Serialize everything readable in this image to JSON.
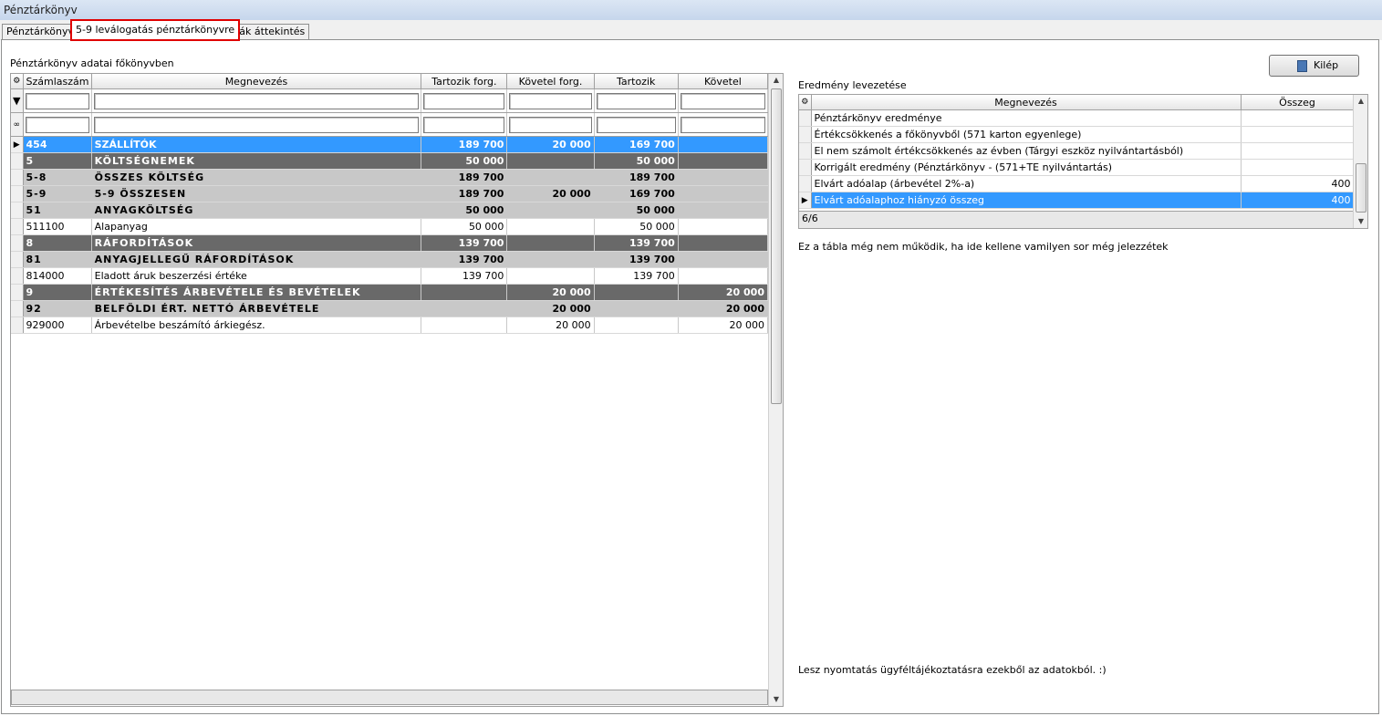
{
  "window": {
    "title": "Pénztárkönyv"
  },
  "tabs": [
    {
      "label": "Pénztárkönyv"
    },
    {
      "label": "5-9 leválogatás pénztárkönyvre"
    },
    {
      "label": "Hibák áttekintés"
    }
  ],
  "left": {
    "section_label": "Pénztárkönyv adatai főkönyvben",
    "columns": [
      "Számlaszám",
      "Megnevezés",
      "Tartozik forg.",
      "Követel forg.",
      "Tartozik",
      "Követel"
    ],
    "rows": [
      {
        "style": "sel",
        "cells": [
          "454",
          "SZÁLLÍTÓK",
          "189 700",
          "20 000",
          "169 700",
          ""
        ]
      },
      {
        "style": "dark",
        "cells": [
          "5",
          "KÖLTSÉGNEMEK",
          "50 000",
          "",
          "50 000",
          ""
        ]
      },
      {
        "style": "light",
        "cells": [
          "5-8",
          "ÖSSZES KÖLTSÉG",
          "189 700",
          "",
          "189 700",
          ""
        ]
      },
      {
        "style": "light",
        "cells": [
          "5-9",
          "5-9 ÖSSZESEN",
          "189 700",
          "20 000",
          "169 700",
          ""
        ]
      },
      {
        "style": "light",
        "cells": [
          "51",
          "ANYAGKÖLTSÉG",
          "50 000",
          "",
          "50 000",
          ""
        ]
      },
      {
        "style": "plain",
        "cells": [
          "511100",
          "Alapanyag",
          "50 000",
          "",
          "50 000",
          ""
        ]
      },
      {
        "style": "dark",
        "cells": [
          "8",
          "RÁFORDÍTÁSOK",
          "139 700",
          "",
          "139 700",
          ""
        ]
      },
      {
        "style": "light",
        "cells": [
          "81",
          "ANYAGJELLEGŰ RÁFORDÍTÁSOK",
          "139 700",
          "",
          "139 700",
          ""
        ]
      },
      {
        "style": "plain",
        "cells": [
          "814000",
          "Eladott áruk beszerzési értéke",
          "139 700",
          "",
          "139 700",
          ""
        ]
      },
      {
        "style": "dark",
        "cells": [
          "9",
          "ÉRTÉKESÍTÉS ÁRBEVÉTELE ÉS BEVÉTELEK",
          "",
          "20 000",
          "",
          "20 000"
        ]
      },
      {
        "style": "light",
        "cells": [
          "92",
          "BELFÖLDI ÉRT. NETTÓ ÁRBEVÉTELE",
          "",
          "20 000",
          "",
          "20 000"
        ]
      },
      {
        "style": "plain",
        "cells": [
          "929000",
          "Árbevételbe beszámító árkiegész.",
          "",
          "20 000",
          "",
          "20 000"
        ]
      }
    ]
  },
  "right": {
    "exit_button": "Kilép",
    "section_label": "Eredmény levezetése",
    "columns": [
      "Megnevezés",
      "Összeg"
    ],
    "rows": [
      {
        "name": "Pénztárkönyv eredménye",
        "amount": ""
      },
      {
        "name": "Értékcsökkenés a főkönyvből (571 karton egyenlege)",
        "amount": ""
      },
      {
        "name": "El nem számolt értékcsökkenés az évben (Tárgyi eszköz nyilvántartásból)",
        "amount": ""
      },
      {
        "name": "Korrigált eredmény (Pénztárkönyv - (571+TE nyilvántartás)",
        "amount": ""
      },
      {
        "name": "Elvárt adóalap (árbevétel 2%-a)",
        "amount": "400"
      },
      {
        "name": "Elvárt adóalaphoz hiányzó összeg",
        "amount": "400"
      }
    ],
    "record_counter": "6/6",
    "note1": "Ez a tábla még nem működik, ha ide kellene vamilyen sor még jelezzétek",
    "note2": "Lesz nyomtatás ügyféltájékoztatásra ezekből az adatokból. :)"
  }
}
